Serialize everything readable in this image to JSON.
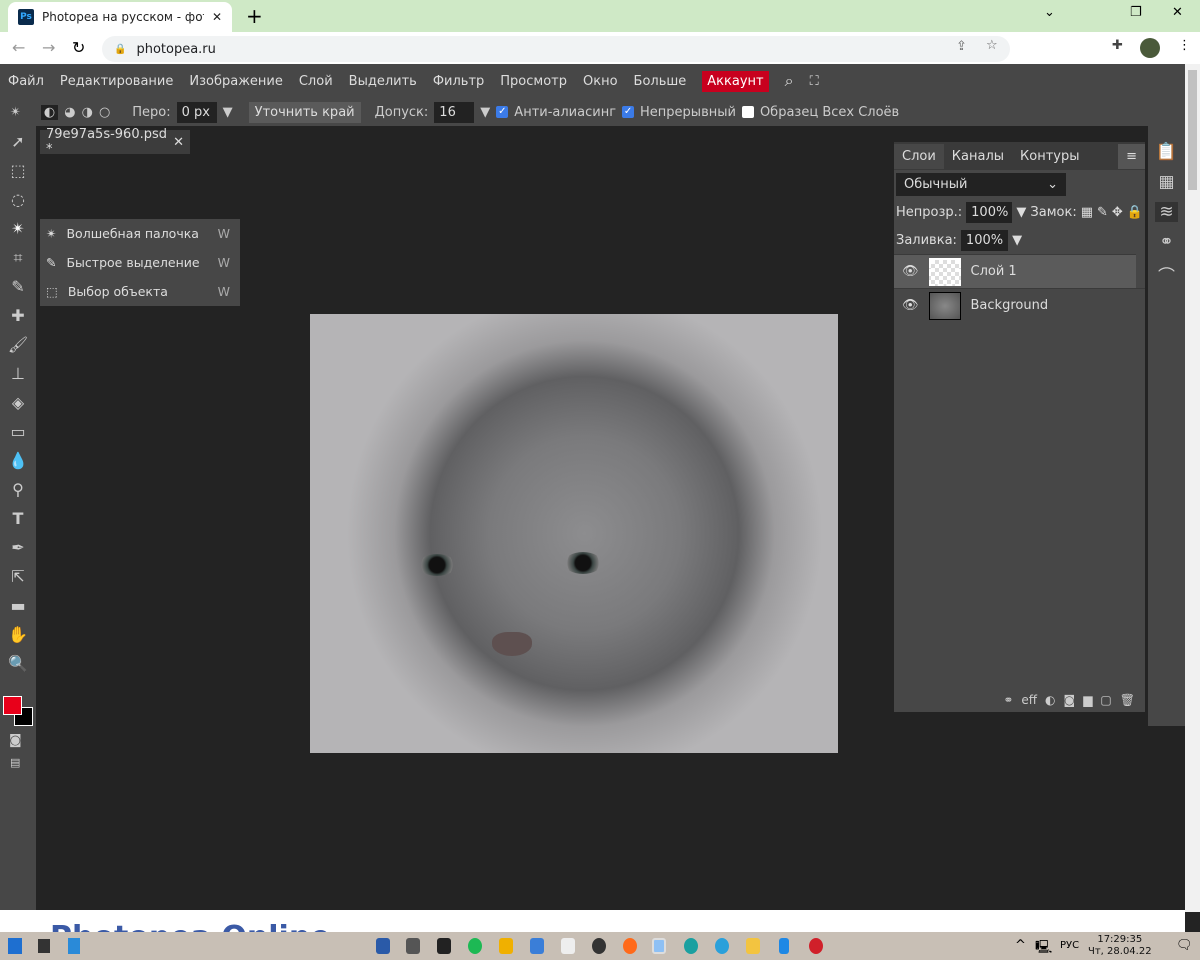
{
  "browser": {
    "tab_title": "Photopea на русском - фоторед",
    "url": "photopea.ru"
  },
  "menu": [
    "Файл",
    "Редактирование",
    "Изображение",
    "Слой",
    "Выделить",
    "Фильтр",
    "Просмотр",
    "Окно",
    "Больше"
  ],
  "account": "Аккаунт",
  "options": {
    "feather_label": "Перо:",
    "feather_value": "0 px",
    "refine_edge": "Уточнить край",
    "tolerance_label": "Допуск:",
    "tolerance_value": "16",
    "anti_alias": "Анти-алиасинг",
    "anti_alias_checked": true,
    "contiguous": "Непрерывный",
    "contiguous_checked": true,
    "sample_all": "Образец Всех Слоёв",
    "sample_all_checked": false
  },
  "document": {
    "tab": "79e97a5s-960.psd *"
  },
  "flyout": [
    {
      "label": "Волшебная палочка",
      "key": "W"
    },
    {
      "label": "Быстрое выделение",
      "key": "W"
    },
    {
      "label": "Выбор объекта",
      "key": "W"
    }
  ],
  "layers_panel": {
    "tabs": [
      "Слои",
      "Каналы",
      "Контуры"
    ],
    "blend_mode": "Обычный",
    "opacity_label": "Непрозр.:",
    "opacity": "100%",
    "lock_label": "Замок:",
    "fill_label": "Заливка:",
    "fill": "100%",
    "layers": [
      {
        "name": "Слой 1",
        "selected": true
      },
      {
        "name": "Background",
        "selected": false
      }
    ],
    "footer_eff": "eff"
  },
  "colors": {
    "foreground": "#e8001a",
    "background": "#000000",
    "accent": "#c8001e"
  },
  "page_text": "Photopea Online",
  "taskbar": {
    "lang": "РУС",
    "time": "17:29:35",
    "date": "Чт, 28.04.22"
  }
}
